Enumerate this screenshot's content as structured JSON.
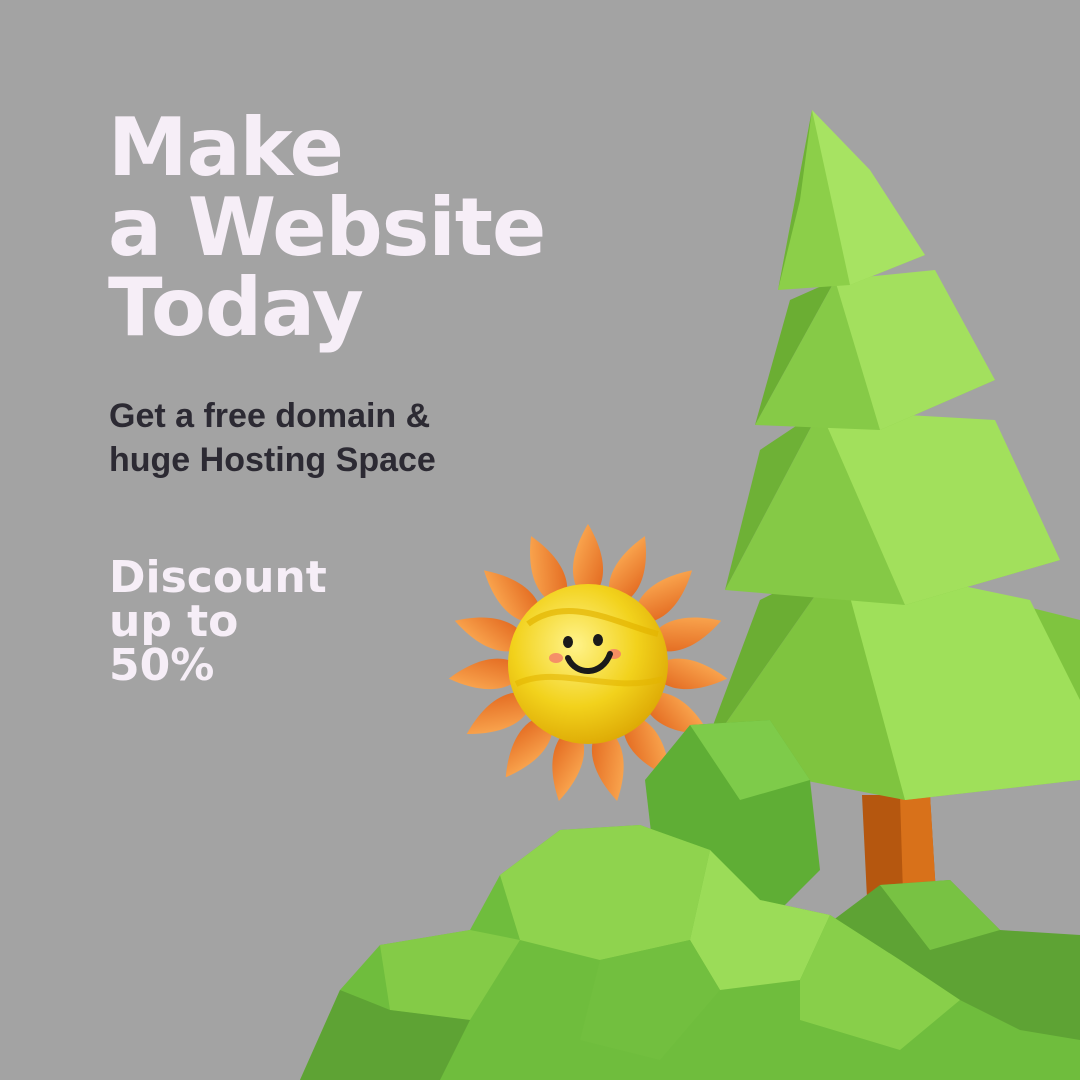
{
  "headline": {
    "line1": "Make",
    "line2": "a Website",
    "line3": "Today"
  },
  "subhead": {
    "line1": "Get a free domain &",
    "line2": "huge Hosting Space"
  },
  "discount": {
    "line1": "Discount",
    "line2": "up to",
    "line3": "50%"
  },
  "colors": {
    "background": "#a3a3a3",
    "headline": "#f6eef7",
    "subhead": "#2c2a33",
    "tree_green": "#8fd14f",
    "sun_petal": "#f28a2e",
    "sun_face": "#f2d21c"
  },
  "illustration": {
    "tree": "pine-tree-icon",
    "sun": "smiling-sun-icon",
    "bushes": "bush-icon"
  }
}
